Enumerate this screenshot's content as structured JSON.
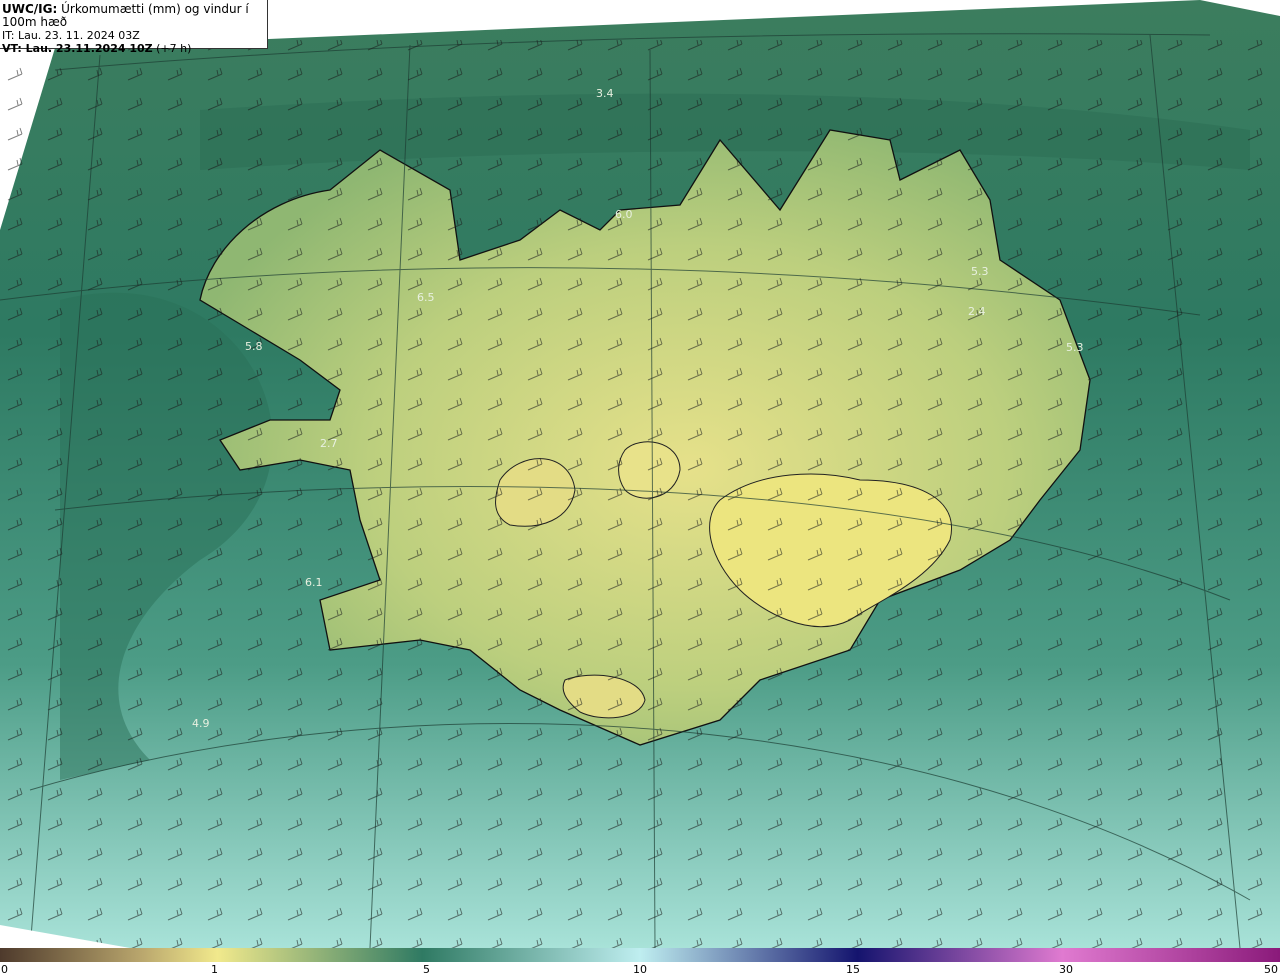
{
  "header": {
    "model": "UWC/IG:",
    "title": "Úrkomumætti (mm) og vindur í 100m hæð",
    "it_label": "IT:",
    "it_value": "Lau. 23. 11. 2024 03Z",
    "vt_label": "VT: Lau. 23.11.2024 10Z",
    "vt_suffix": "(+7 h)"
  },
  "map_values": [
    {
      "text": "3.4"
    },
    {
      "text": "6.0"
    },
    {
      "text": "6.5"
    },
    {
      "text": "5.8"
    },
    {
      "text": "5.3"
    },
    {
      "text": "2.4"
    },
    {
      "text": "5.3"
    },
    {
      "text": "2.7"
    },
    {
      "text": "6.1"
    },
    {
      "text": "4.9"
    }
  ],
  "colorbar": {
    "ticks": [
      "0",
      "1",
      "5",
      "10",
      "15",
      "30",
      "50"
    ],
    "stops": [
      "#4e3a2c",
      "#b9a66d",
      "#f1e98c",
      "#2f7a63",
      "#bfeef0",
      "#14146e",
      "#e07ad0",
      "#8a1a7a"
    ]
  },
  "colors": {
    "ocean": "#2f7a63",
    "land_light": "#e6e08a",
    "land_mid": "#a9c27a",
    "coast": "#111111"
  }
}
